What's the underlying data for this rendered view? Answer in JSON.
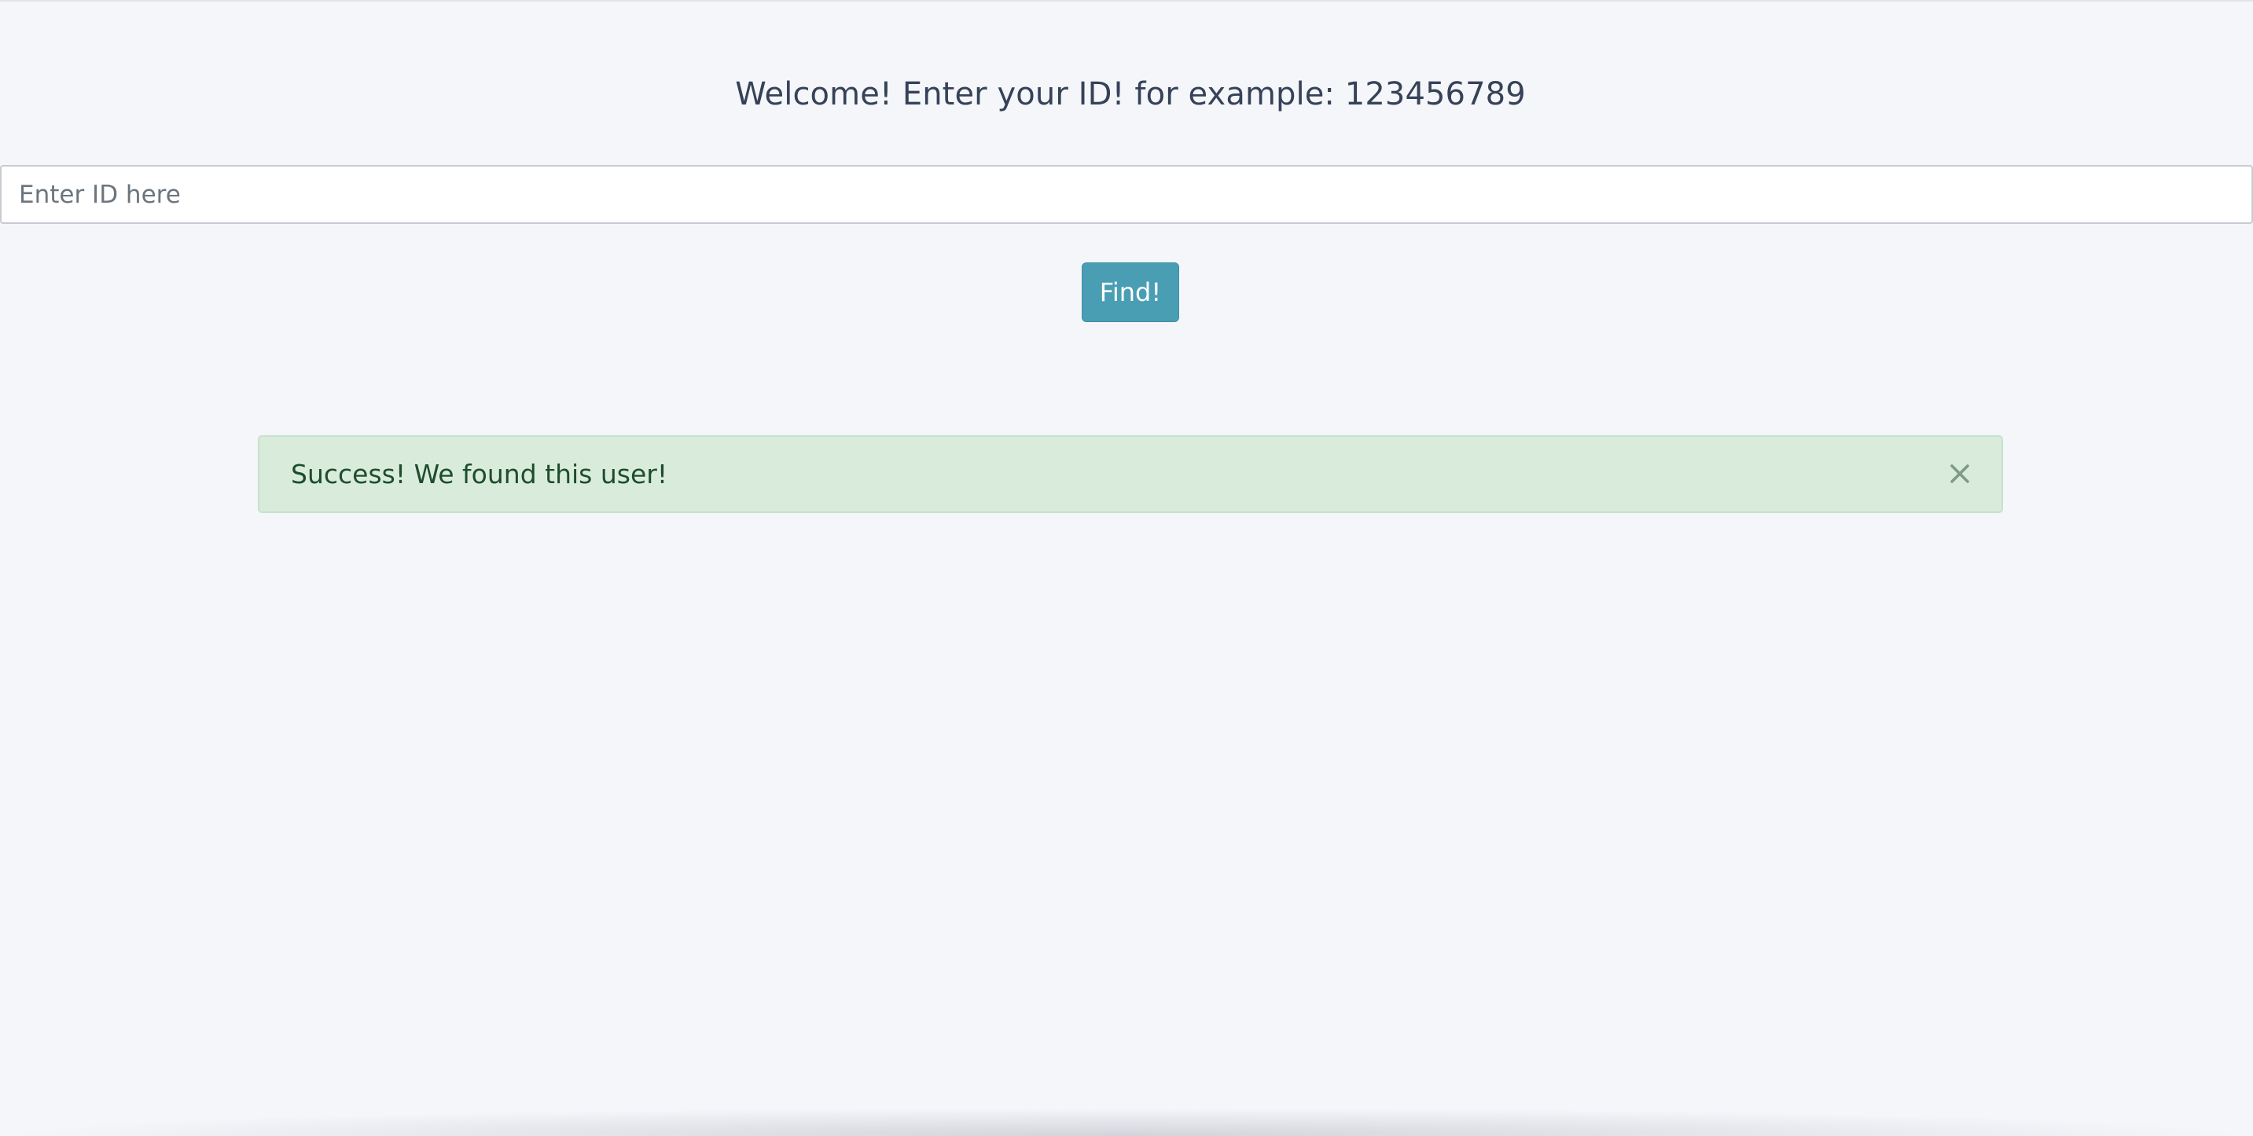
{
  "heading": "Welcome! Enter your ID! for example: 123456789",
  "search": {
    "value": "",
    "placeholder": "Enter ID here"
  },
  "find_button_label": "Find!",
  "alert": {
    "strong": "Success!",
    "message": " We found this user!",
    "close_icon": "close-icon",
    "status_color": "#d9ecdc"
  },
  "colors": {
    "background": "#f5f6fa",
    "accent": "#4a9eb4",
    "heading_text": "#364258",
    "success_text": "#1e4d2b"
  }
}
